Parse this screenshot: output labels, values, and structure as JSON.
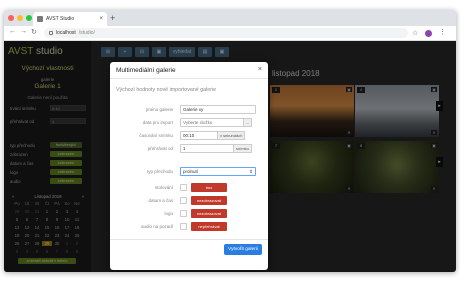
{
  "browser": {
    "tab_title": "AVST Studio",
    "tab_close": "×",
    "new_tab": "+",
    "url_host": "localhost",
    "url_path": "/studio/",
    "back": "←",
    "forward": "→",
    "reload": "↻",
    "star": "☆",
    "menu": "⋮",
    "colors": {
      "close": "#ff5f57",
      "min": "#febc2e",
      "max": "#28c840",
      "avatar": "#8e44ad"
    }
  },
  "sidebar": {
    "brand_a": "AVST",
    "brand_b": " studio",
    "section_title": "Výchozí vlastnosti",
    "gallery_label": "galerie",
    "gallery_name": "Galerie 1",
    "gallery_status": "Galerie není použita",
    "fields": [
      {
        "label": "trvání snímku",
        "value": "0:10"
      },
      {
        "label": "přehrávat od",
        "value": "1"
      }
    ],
    "toggles": [
      {
        "label": "typ přechodu",
        "value": "hodvibrující"
      },
      {
        "label": "zobrazen",
        "value": "zobrazen"
      },
      {
        "label": "datum a čas",
        "value": "zobrazen"
      },
      {
        "label": "logo",
        "value": "zobrazen"
      },
      {
        "label": "audio",
        "value": "zobrazen"
      }
    ],
    "calendar": {
      "month": "Listopad 2018",
      "prev": "«",
      "next": "»",
      "days": [
        "Po",
        "Út",
        "St",
        "Čt",
        "Pá",
        "So",
        "Ne"
      ],
      "cells": [
        "29",
        "30",
        "31",
        "1",
        "2",
        "3",
        "4",
        "5",
        "6",
        "7",
        "8",
        "9",
        "10",
        "11",
        "12",
        "13",
        "14",
        "15",
        "16",
        "17",
        "18",
        "19",
        "20",
        "21",
        "22",
        "23",
        "24",
        "25",
        "26",
        "27",
        "28",
        "29",
        "30",
        "1",
        "2",
        "3",
        "4",
        "5",
        "6",
        "7",
        "8",
        "9"
      ],
      "today": "29",
      "button": "zobrazit aktuální měsíc"
    }
  },
  "main": {
    "toolbar": [
      "⊞",
      "+",
      "⊟",
      "▣",
      "vyhledat",
      "▤",
      "▣"
    ],
    "date_heading": "listopad 2018",
    "thumbs": [
      {
        "num": "2"
      },
      {
        "num": "4"
      },
      {
        "num": "7"
      },
      {
        "num": "8"
      }
    ]
  },
  "modal": {
    "title": "Multimediální galerie",
    "close": "×",
    "subtitle": "Výchozí hodnoty nově importované galerie",
    "name_label": "jméno galerie",
    "name_value": "Galerie xy",
    "folder_label": "data pro import",
    "folder_placeholder": "Vyberte složku",
    "folder_btn": "...",
    "duration_label": "časování snímku",
    "duration_value": "00:10",
    "duration_unit": "v sekundách",
    "start_label": "přehrávat od",
    "start_value": "1",
    "start_unit": "snímku",
    "transition_label": "typ přechodu",
    "transition_value": "prolnutí",
    "checks": [
      {
        "label": "stolování",
        "btn": "box"
      },
      {
        "label": "datum a čas",
        "btn": "nezobrazovat"
      },
      {
        "label": "logo",
        "btn": "nezobrazovat"
      },
      {
        "label": "audio na pozadí",
        "btn": "nepřehrávat"
      }
    ],
    "submit": "Vytvořit galerii"
  }
}
